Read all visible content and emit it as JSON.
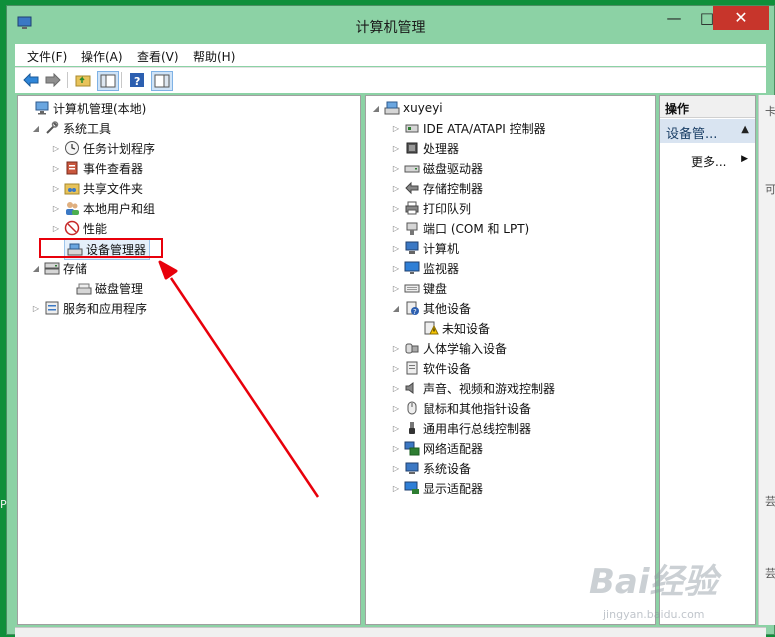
{
  "window": {
    "title": "计算机管理"
  },
  "controls": {
    "minimize": "—",
    "maximize": "□",
    "close": "✕"
  },
  "menubar": [
    {
      "label": "文件(F)"
    },
    {
      "label": "操作(A)"
    },
    {
      "label": "查看(V)"
    },
    {
      "label": "帮助(H)"
    }
  ],
  "toolbar": [
    "back-icon",
    "forward-icon",
    "up-folder-icon",
    "show-hide-tree-icon",
    "help-icon",
    "properties-icon"
  ],
  "left_tree": [
    {
      "label": "计算机管理(本地)",
      "icon": "computer-management-icon",
      "expander": ""
    },
    {
      "label": "系统工具",
      "icon": "system-tools-icon",
      "expander": "◢"
    },
    {
      "label": "任务计划程序",
      "icon": "task-scheduler-icon",
      "expander": "▷"
    },
    {
      "label": "事件查看器",
      "icon": "event-viewer-icon",
      "expander": "▷"
    },
    {
      "label": "共享文件夹",
      "icon": "shared-folder-icon",
      "expander": "▷"
    },
    {
      "label": "本地用户和组",
      "icon": "users-icon",
      "expander": "▷"
    },
    {
      "label": "性能",
      "icon": "performance-icon",
      "expander": "▷"
    },
    {
      "label": "设备管理器",
      "icon": "device-manager-icon",
      "expander": ""
    },
    {
      "label": "存储",
      "icon": "storage-icon",
      "expander": "◢"
    },
    {
      "label": "磁盘管理",
      "icon": "disk-management-icon",
      "expander": ""
    },
    {
      "label": "服务和应用程序",
      "icon": "services-icon",
      "expander": "▷"
    }
  ],
  "device_tree": {
    "root": {
      "label": "xuyeyi",
      "icon": "computer-icon",
      "expander": "◢"
    },
    "items": [
      {
        "label": "IDE ATA/ATAPI 控制器",
        "icon": "ide-controller-icon",
        "expander": "▷"
      },
      {
        "label": "处理器",
        "icon": "processor-icon",
        "expander": "▷"
      },
      {
        "label": "磁盘驱动器",
        "icon": "disk-drive-icon",
        "expander": "▷"
      },
      {
        "label": "存储控制器",
        "icon": "storage-controller-icon",
        "expander": "▷"
      },
      {
        "label": "打印队列",
        "icon": "printer-icon",
        "expander": "▷"
      },
      {
        "label": "端口 (COM 和 LPT)",
        "icon": "port-icon",
        "expander": "▷"
      },
      {
        "label": "计算机",
        "icon": "computer-icon",
        "expander": "▷"
      },
      {
        "label": "监视器",
        "icon": "monitor-icon",
        "expander": "▷"
      },
      {
        "label": "键盘",
        "icon": "keyboard-icon",
        "expander": "▷"
      },
      {
        "label": "其他设备",
        "icon": "other-devices-icon",
        "expander": "◢"
      },
      {
        "label": "未知设备",
        "icon": "unknown-device-warning-icon",
        "expander": ""
      },
      {
        "label": "人体学输入设备",
        "icon": "hid-icon",
        "expander": "▷"
      },
      {
        "label": "软件设备",
        "icon": "software-device-icon",
        "expander": "▷"
      },
      {
        "label": "声音、视频和游戏控制器",
        "icon": "sound-icon",
        "expander": "▷"
      },
      {
        "label": "鼠标和其他指针设备",
        "icon": "mouse-icon",
        "expander": "▷"
      },
      {
        "label": "通用串行总线控制器",
        "icon": "usb-icon",
        "expander": "▷"
      },
      {
        "label": "网络适配器",
        "icon": "network-adapter-icon",
        "expander": "▷"
      },
      {
        "label": "系统设备",
        "icon": "system-device-icon",
        "expander": "▷"
      },
      {
        "label": "显示适配器",
        "icon": "display-adapter-icon",
        "expander": "▷"
      }
    ]
  },
  "actions": {
    "header": "操作",
    "section": "设备管...",
    "section_caret": "▲",
    "more": "更多...",
    "more_caret": "▶"
  },
  "watermark": {
    "main": "Bai经验",
    "sub": "jingyan.baidu.com"
  },
  "desktop_fragment": "P",
  "side_fragments": [
    "卡",
    "可",
    "芸",
    "芸"
  ],
  "colors": {
    "desktop": "#0f8f3a",
    "window_frame": "#8cd2a5",
    "close_button": "#c7352b",
    "highlight_box": "#e8000b",
    "arrow": "#e8000b",
    "actions_section_bg": "#d9e4f1"
  }
}
